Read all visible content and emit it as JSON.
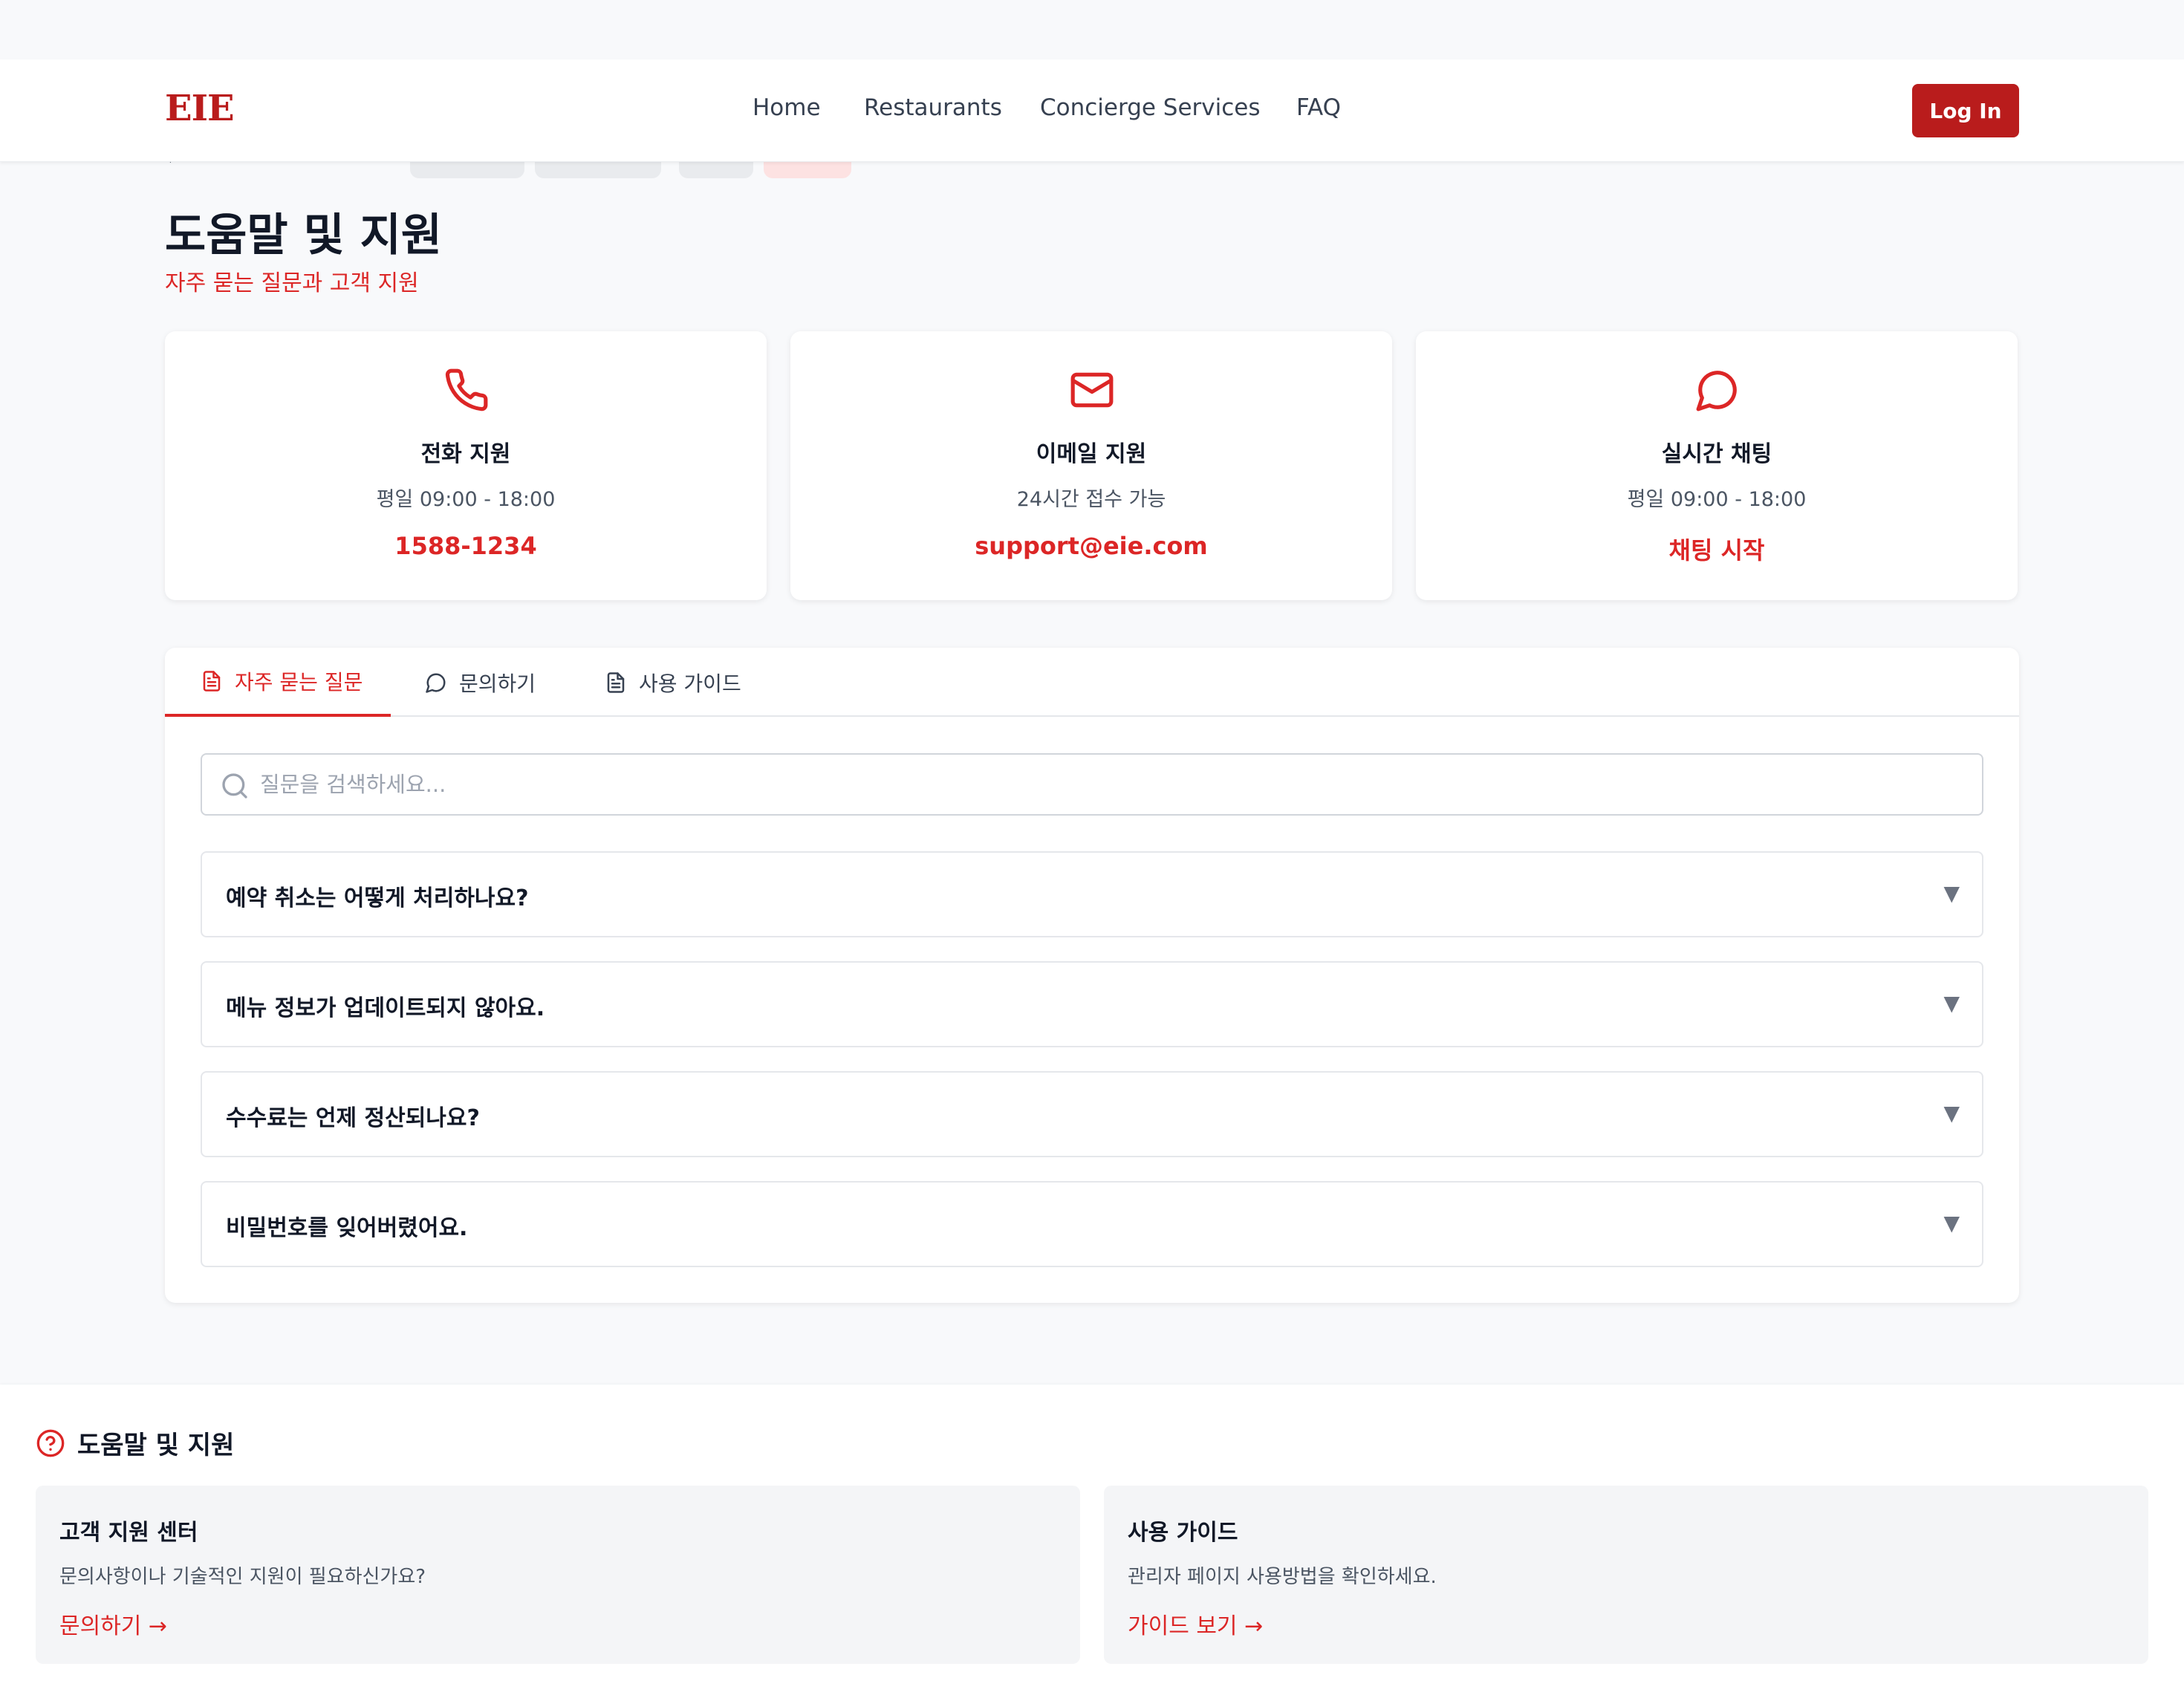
{
  "header": {
    "logo": "EIE",
    "nav": [
      "Home",
      "Restaurants",
      "Concierge Services",
      "FAQ"
    ],
    "login_label": "Log In"
  },
  "page": {
    "title": "도움말 및 지원",
    "subtitle": "자주 묻는 질문과 고객 지원"
  },
  "contacts": [
    {
      "icon": "phone-icon",
      "title": "전화 지원",
      "hours": "평일 09:00 - 18:00",
      "value": "1588-1234"
    },
    {
      "icon": "mail-icon",
      "title": "이메일 지원",
      "hours": "24시간 접수 가능",
      "value": "support@eie.com"
    },
    {
      "icon": "chat-icon",
      "title": "실시간 채팅",
      "hours": "평일 09:00 - 18:00",
      "value": "채팅 시작"
    }
  ],
  "tabs": [
    {
      "icon": "document-icon",
      "label": "자주 묻는 질문",
      "active": true
    },
    {
      "icon": "chat-icon",
      "label": "문의하기",
      "active": false
    },
    {
      "icon": "document-icon",
      "label": "사용 가이드",
      "active": false
    }
  ],
  "search": {
    "placeholder": "질문을 검색하세요..."
  },
  "faqs": [
    {
      "question": "예약 취소는 어떻게 처리하나요?",
      "arrow": "▼"
    },
    {
      "question": "메뉴 정보가 업데이트되지 않아요.",
      "arrow": "▼"
    },
    {
      "question": "수수료는 언제 정산되나요?",
      "arrow": "▼"
    },
    {
      "question": "비밀번호를 잊어버렸어요.",
      "arrow": "▼"
    }
  ],
  "help": {
    "title": "도움말 및 지원",
    "cards": [
      {
        "title": "고객 지원 센터",
        "desc": "문의사항이나 기술적인 지원이 필요하신가요?",
        "link": "문의하기 →"
      },
      {
        "title": "사용 가이드",
        "desc": "관리자 페이지 사용방법을 확인하세요.",
        "link": "가이드 보기 →"
      }
    ]
  },
  "colors": {
    "accent": "#dc2626",
    "brand": "#b91c1c",
    "background": "#f8f9fb"
  }
}
